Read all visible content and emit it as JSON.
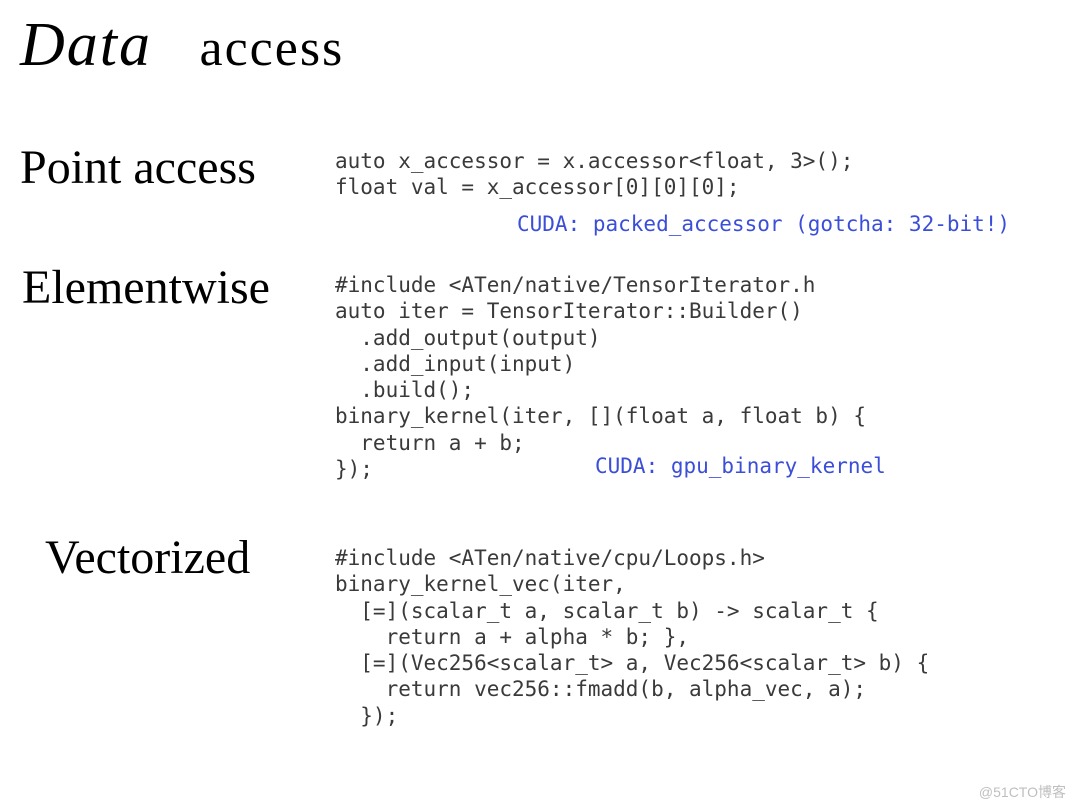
{
  "title": {
    "word1": "Data",
    "word2": "access"
  },
  "labels": {
    "point": "Point access",
    "elementwise": "Elementwise",
    "vectorized": "Vectorized"
  },
  "code": {
    "point": "auto x_accessor = x.accessor<float, 3>();\nfloat val = x_accessor[0][0][0];",
    "elementwise": "#include <ATen/native/TensorIterator.h\nauto iter = TensorIterator::Builder()\n  .add_output(output)\n  .add_input(input)\n  .build();\nbinary_kernel(iter, [](float a, float b) {\n  return a + b;\n});",
    "vectorized": "#include <ATen/native/cpu/Loops.h>\nbinary_kernel_vec(iter,\n  [=](scalar_t a, scalar_t b) -> scalar_t {\n    return a + alpha * b; },\n  [=](Vec256<scalar_t> a, Vec256<scalar_t> b) {\n    return vec256::fmadd(b, alpha_vec, a);\n  });"
  },
  "notes": {
    "point": "CUDA: packed_accessor (gotcha: 32-bit!)",
    "elementwise": "CUDA: gpu_binary_kernel"
  },
  "watermark": "@51CTO博客"
}
